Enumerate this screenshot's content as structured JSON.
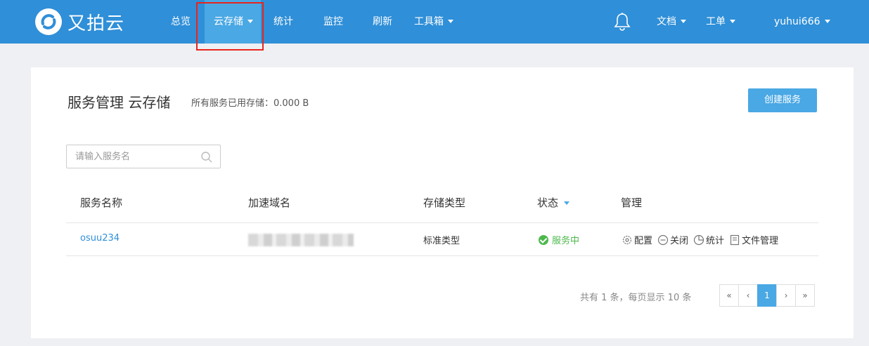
{
  "brand": {
    "name": "又拍云"
  },
  "nav": {
    "items": [
      {
        "label": "总览"
      },
      {
        "label": "云存储",
        "active": true,
        "dropdown": true
      },
      {
        "label": "统计"
      },
      {
        "label": "监控"
      },
      {
        "label": "刷新"
      },
      {
        "label": "工具箱",
        "dropdown": true
      }
    ],
    "right": {
      "docs_label": "文档",
      "ticket_label": "工单",
      "username": "yuhui666"
    }
  },
  "page": {
    "title": "服务管理 云存储",
    "storage_summary": "所有服务已用存储：0.000 B",
    "create_button": "创建服务",
    "search_placeholder": "请输入服务名"
  },
  "table": {
    "headers": [
      "服务名称",
      "加速域名",
      "存储类型",
      "状态",
      "管理"
    ],
    "rows": [
      {
        "name": "osuu234",
        "domain": "",
        "storage_type": "标准类型",
        "status": "服务中",
        "actions": [
          "配置",
          "关闭",
          "统计",
          "文件管理"
        ]
      }
    ]
  },
  "pagination": {
    "summary": "共有 1 条，每页显示 10 条",
    "first": "«",
    "prev": "‹",
    "current": "1",
    "next": "›",
    "last": "»"
  },
  "colors": {
    "nav_bg": "#2f8fd8",
    "accent": "#4aa8e4",
    "status_ok": "#4cb84c",
    "highlight": "#e8251c"
  }
}
